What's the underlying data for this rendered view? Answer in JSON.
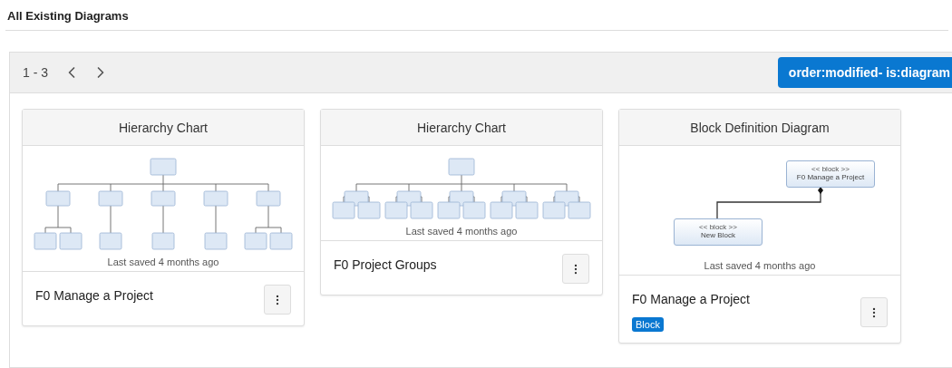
{
  "title": "All Existing Diagrams",
  "pager": {
    "range": "1 - 3"
  },
  "filter": {
    "label": "order:modified- is:diagram"
  },
  "cards": [
    {
      "kind": "hierarchy",
      "type": "Hierarchy Chart",
      "saved": "Last saved 4 months ago",
      "name": "F0 Manage a Project"
    },
    {
      "kind": "hierarchy",
      "type": "Hierarchy Chart",
      "saved": "Last saved 4 months ago",
      "name": "F0 Project Groups"
    },
    {
      "kind": "block",
      "type": "Block Definition Diagram",
      "saved": "Last saved 4 months ago",
      "name": "F0 Manage a Project",
      "tag": "Block",
      "blocks": [
        {
          "stereotype": "<< block >>",
          "label": "F0 Manage a Project"
        },
        {
          "stereotype": "<< block >>",
          "label": "New Block"
        }
      ]
    }
  ]
}
